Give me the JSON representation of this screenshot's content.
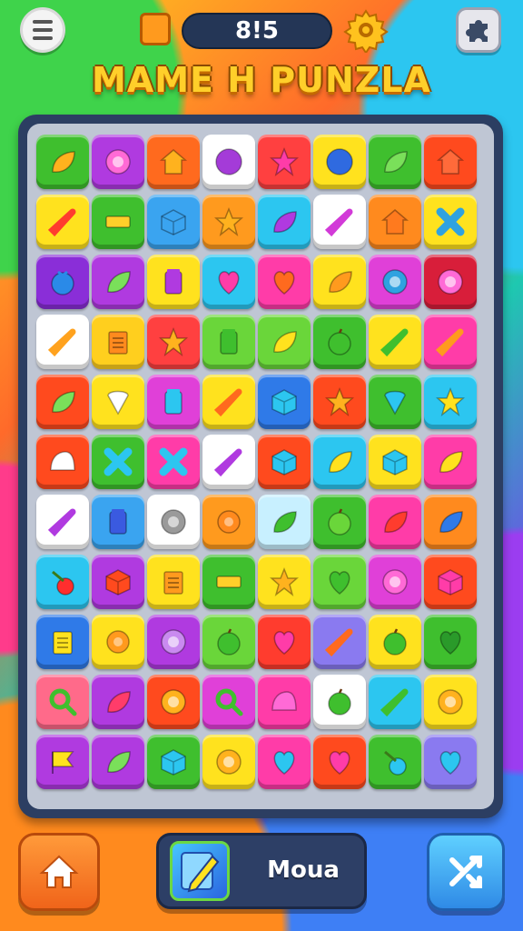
{
  "header": {
    "score_text": "8!5",
    "icons": {
      "menu": "menu-icon",
      "moves": "orange-square-icon",
      "settings": "gear-icon",
      "extras": "puzzle-piece-icon"
    }
  },
  "title": "MAME H PUNZLA",
  "footer": {
    "mode_label": "Moua",
    "icons": {
      "home": "home-icon",
      "mode": "pencil-icon",
      "shuffle": "shuffle-icon"
    }
  },
  "board": {
    "columns": 8,
    "rows": 11,
    "tiles": [
      [
        {
          "bg": "#3fbf2e",
          "sym": "leaf",
          "fg": "#ffb21e"
        },
        {
          "bg": "#b03ae0",
          "sym": "ring",
          "fg": "#ff6ad6"
        },
        {
          "bg": "#ff6a1e",
          "sym": "house",
          "fg": "#ffb21e"
        },
        {
          "bg": "#ffffff",
          "sym": "circle",
          "fg": "#a43bd8"
        },
        {
          "bg": "#ff4040",
          "sym": "star",
          "fg": "#ff3ca8"
        },
        {
          "bg": "#ffe21e",
          "sym": "circle",
          "fg": "#2f6ae0"
        },
        {
          "bg": "#3fbf2e",
          "sym": "leaf",
          "fg": "#7ae05a"
        },
        {
          "bg": "#ff4a1e",
          "sym": "house",
          "fg": "#ff6a3a"
        }
      ],
      [
        {
          "bg": "#ffe21e",
          "sym": "carrot",
          "fg": "#ff3c2e"
        },
        {
          "bg": "#3fbf2e",
          "sym": "bar",
          "fg": "#ffcf2a"
        },
        {
          "bg": "#3aa4f0",
          "sym": "cube",
          "fg": "#3aa4f0"
        },
        {
          "bg": "#ff9a1e",
          "sym": "star",
          "fg": "#ffb21e"
        },
        {
          "bg": "#2cc6f0",
          "sym": "leaf",
          "fg": "#b03ae0"
        },
        {
          "bg": "#ffffff",
          "sym": "carrot",
          "fg": "#d23ad8"
        },
        {
          "bg": "#ff8a1e",
          "sym": "house",
          "fg": "#ff7a1e"
        },
        {
          "bg": "#ffe21e",
          "sym": "cross",
          "fg": "#2fa2e0"
        }
      ],
      [
        {
          "bg": "#8a2ed8",
          "sym": "berry",
          "fg": "#2a8ae8"
        },
        {
          "bg": "#b03ae0",
          "sym": "leaf",
          "fg": "#7ae05a"
        },
        {
          "bg": "#ffe21e",
          "sym": "jar",
          "fg": "#b03ae0"
        },
        {
          "bg": "#2cc6f0",
          "sym": "heart",
          "fg": "#ff3ca8"
        },
        {
          "bg": "#ff3ca8",
          "sym": "heart",
          "fg": "#ff6a1e"
        },
        {
          "bg": "#ffe21e",
          "sym": "leaf",
          "fg": "#ff9a1e"
        },
        {
          "bg": "#e040d8",
          "sym": "ring",
          "fg": "#2fa2e0"
        },
        {
          "bg": "#d81e3a",
          "sym": "ring",
          "fg": "#ff6ad6"
        }
      ],
      [
        {
          "bg": "#ffffff",
          "sym": "carrot",
          "fg": "#ffa21e"
        },
        {
          "bg": "#ffcf1e",
          "sym": "clip",
          "fg": "#ff8a1e"
        },
        {
          "bg": "#ff4040",
          "sym": "star",
          "fg": "#ffb21e"
        },
        {
          "bg": "#6ad63a",
          "sym": "jar",
          "fg": "#3fbf2e"
        },
        {
          "bg": "#6ad63a",
          "sym": "leaf",
          "fg": "#ffe21e"
        },
        {
          "bg": "#3fbf2e",
          "sym": "apple",
          "fg": "#3fbf2e"
        },
        {
          "bg": "#ffe21e",
          "sym": "carrot",
          "fg": "#3fbf2e"
        },
        {
          "bg": "#ff3ca8",
          "sym": "carrot",
          "fg": "#ff9a1e"
        }
      ],
      [
        {
          "bg": "#ff4a1e",
          "sym": "leaf",
          "fg": "#7ae05a"
        },
        {
          "bg": "#ffe21e",
          "sym": "cone",
          "fg": "#ffffff"
        },
        {
          "bg": "#e040d8",
          "sym": "jar",
          "fg": "#2cc6f0"
        },
        {
          "bg": "#ffe21e",
          "sym": "carrot",
          "fg": "#ff6a1e"
        },
        {
          "bg": "#2f7ae8",
          "sym": "cube",
          "fg": "#2cc6f0"
        },
        {
          "bg": "#ff4a1e",
          "sym": "star",
          "fg": "#ffb21e"
        },
        {
          "bg": "#3fbf2e",
          "sym": "cone",
          "fg": "#2cc6f0"
        },
        {
          "bg": "#2cc6f0",
          "sym": "star",
          "fg": "#ffe21e"
        }
      ],
      [
        {
          "bg": "#ff4a1e",
          "sym": "cap",
          "fg": "#ffffff"
        },
        {
          "bg": "#3fbf2e",
          "sym": "cross",
          "fg": "#2cc6f0"
        },
        {
          "bg": "#ff3ca8",
          "sym": "cross",
          "fg": "#2cc6f0"
        },
        {
          "bg": "#ffffff",
          "sym": "carrot",
          "fg": "#b03ae0"
        },
        {
          "bg": "#ff4a1e",
          "sym": "cube",
          "fg": "#2cc6f0"
        },
        {
          "bg": "#2cc6f0",
          "sym": "leaf",
          "fg": "#ffe21e"
        },
        {
          "bg": "#ffe21e",
          "sym": "cube",
          "fg": "#2cc6f0"
        },
        {
          "bg": "#ff3ca8",
          "sym": "leaf",
          "fg": "#ffe21e"
        }
      ],
      [
        {
          "bg": "#ffffff",
          "sym": "carrot",
          "fg": "#b03ae0"
        },
        {
          "bg": "#3aa4f0",
          "sym": "jar",
          "fg": "#3a5ae0"
        },
        {
          "bg": "#ffffff",
          "sym": "ring",
          "fg": "#9a9a9a"
        },
        {
          "bg": "#ff9a1e",
          "sym": "flower",
          "fg": "#ff8a1e"
        },
        {
          "bg": "#c8f0ff",
          "sym": "leaf",
          "fg": "#3fbf2e"
        },
        {
          "bg": "#3fbf2e",
          "sym": "apple",
          "fg": "#6ad63a"
        },
        {
          "bg": "#ff3ca8",
          "sym": "leaf",
          "fg": "#ff3c2e"
        },
        {
          "bg": "#ff8a1e",
          "sym": "leaf",
          "fg": "#2f7ae8"
        }
      ],
      [
        {
          "bg": "#2cc6f0",
          "sym": "cherry",
          "fg": "#ff2e2e"
        },
        {
          "bg": "#b03ae0",
          "sym": "cube",
          "fg": "#ff4a1e"
        },
        {
          "bg": "#ffe21e",
          "sym": "clip",
          "fg": "#ff9a1e"
        },
        {
          "bg": "#3fbf2e",
          "sym": "bar",
          "fg": "#ffcf2a"
        },
        {
          "bg": "#ffe21e",
          "sym": "star",
          "fg": "#ffb21e"
        },
        {
          "bg": "#6ad63a",
          "sym": "heart",
          "fg": "#3fbf2e"
        },
        {
          "bg": "#e040d8",
          "sym": "ring",
          "fg": "#ff6ad6"
        },
        {
          "bg": "#ff4a1e",
          "sym": "cube",
          "fg": "#ff3ca8"
        }
      ],
      [
        {
          "bg": "#2f7ae8",
          "sym": "clip",
          "fg": "#ffe21e"
        },
        {
          "bg": "#ffe21e",
          "sym": "flower",
          "fg": "#ff9a1e"
        },
        {
          "bg": "#b03ae0",
          "sym": "ring",
          "fg": "#c98af0"
        },
        {
          "bg": "#6ad63a",
          "sym": "apple",
          "fg": "#3fbf2e"
        },
        {
          "bg": "#ff3c2e",
          "sym": "heart",
          "fg": "#ff3ca8"
        },
        {
          "bg": "#8a7af0",
          "sym": "carrot",
          "fg": "#ff6a1e"
        },
        {
          "bg": "#ffe21e",
          "sym": "apple",
          "fg": "#3fbf2e"
        },
        {
          "bg": "#3fbf2e",
          "sym": "heart",
          "fg": "#2a9a2a"
        }
      ],
      [
        {
          "bg": "#ff6a8a",
          "sym": "magnify",
          "fg": "#3fbf2e"
        },
        {
          "bg": "#b03ae0",
          "sym": "leaf",
          "fg": "#ff3c6a"
        },
        {
          "bg": "#ff4a1e",
          "sym": "ring",
          "fg": "#ffb21e"
        },
        {
          "bg": "#e040d8",
          "sym": "magnify",
          "fg": "#3fbf2e"
        },
        {
          "bg": "#ff3ca8",
          "sym": "cap",
          "fg": "#ff6ad6"
        },
        {
          "bg": "#ffffff",
          "sym": "apple",
          "fg": "#3fbf2e"
        },
        {
          "bg": "#2cc6f0",
          "sym": "carrot",
          "fg": "#3fbf2e"
        },
        {
          "bg": "#ffe21e",
          "sym": "ring",
          "fg": "#ffb21e"
        }
      ],
      [
        {
          "bg": "#b03ae0",
          "sym": "flag",
          "fg": "#ffe21e"
        },
        {
          "bg": "#b03ae0",
          "sym": "leaf",
          "fg": "#7ae05a"
        },
        {
          "bg": "#3fbf2e",
          "sym": "cube",
          "fg": "#2cc6f0"
        },
        {
          "bg": "#ffe21e",
          "sym": "ring",
          "fg": "#ffb21e"
        },
        {
          "bg": "#ff3ca8",
          "sym": "heart",
          "fg": "#2cc6f0"
        },
        {
          "bg": "#ff4a1e",
          "sym": "heart",
          "fg": "#ff3ca8"
        },
        {
          "bg": "#3fbf2e",
          "sym": "cherry",
          "fg": "#2cc6f0"
        },
        {
          "bg": "#8a7af0",
          "sym": "heart",
          "fg": "#2cc6f0"
        }
      ]
    ]
  }
}
